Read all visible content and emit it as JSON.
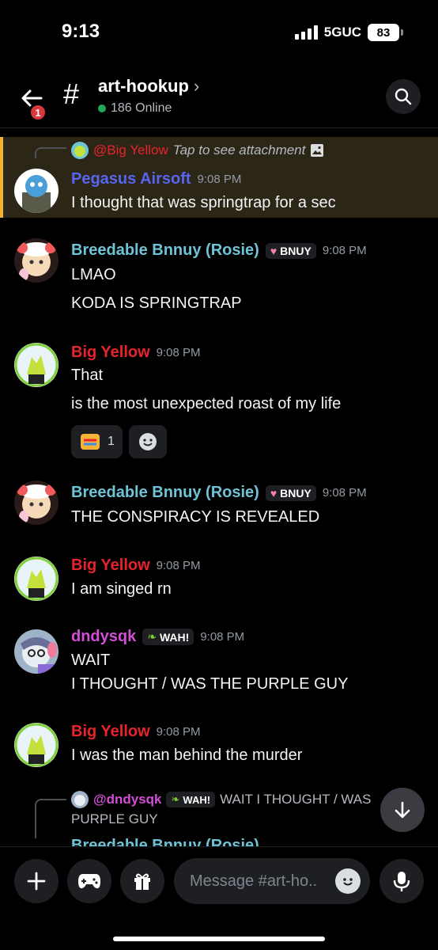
{
  "status_bar": {
    "time": "9:13",
    "network": "5GUC",
    "battery": "83"
  },
  "header": {
    "back_badge": "1",
    "hash": "#",
    "channel": "art-hookup",
    "chevron": "›",
    "online": "186 Online"
  },
  "colors": {
    "accent_yellow": "#f0b232",
    "online_green": "#23a55a",
    "red_name": "#e8232b",
    "blue_name": "#6fc3d6",
    "pink_name": "#d24fd6",
    "purple_name": "#5865f2"
  },
  "messages": [
    {
      "reply_mention": "@Big Yellow",
      "reply_text": "Tap to see attachment",
      "user": "Pegasus Airsoft",
      "time": "9:08 PM",
      "lines": [
        "I thought that was springtrap for a sec"
      ]
    },
    {
      "user": "Breedable Bnnuy (Rosie)",
      "tag": "BNUY",
      "time": "9:08 PM",
      "lines": [
        "LMAO",
        "KODA IS SPRINGTRAP"
      ]
    },
    {
      "user": "Big Yellow",
      "time": "9:08 PM",
      "lines": [
        "That",
        "is the most unexpected roast of my life"
      ],
      "reaction_count": "1"
    },
    {
      "user": "Breedable Bnnuy (Rosie)",
      "tag": "BNUY",
      "time": "9:08 PM",
      "lines": [
        "THE CONSPIRACY IS REVEALED"
      ]
    },
    {
      "user": "Big Yellow",
      "time": "9:08 PM",
      "lines": [
        "I am singed rn"
      ]
    },
    {
      "user": "dndysqk",
      "tag": "WAH!",
      "time": "9:08 PM",
      "lines": [
        "WAIT",
        "I THOUGHT / WAS THE PURPLE GUY"
      ]
    },
    {
      "user": "Big Yellow",
      "time": "9:08 PM",
      "lines": [
        "I was the man behind the murder"
      ]
    },
    {
      "reply_mention": "@dndysqk",
      "reply_tag": "WAH!",
      "reply_text": "WAIT I THOUGHT / WAS",
      "reply_text_2": "PURPLE GUY",
      "user": "Breedable Bnnuy (Rosie)"
    }
  ],
  "composer": {
    "placeholder": "Message #art-ho.."
  },
  "icons": [
    "back-arrow-icon",
    "hash-icon",
    "search-icon",
    "reaction-emoji-icon",
    "add-reaction-icon",
    "scroll-down-icon",
    "plus-icon",
    "gamepad-icon",
    "gift-icon",
    "emoji-icon",
    "microphone-icon",
    "image-icon"
  ]
}
